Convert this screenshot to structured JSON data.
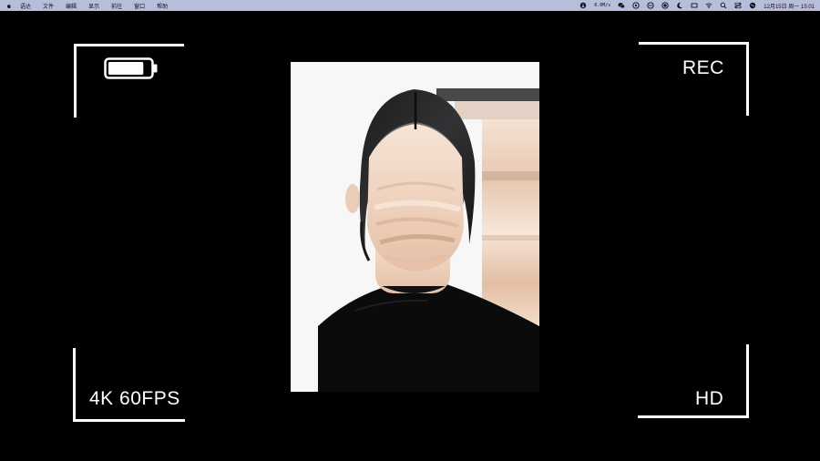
{
  "menubar": {
    "menus": [
      "语达",
      "文件",
      "编辑",
      "显示",
      "前往",
      "窗口",
      "帮助"
    ],
    "net_speed": "0.0M/s",
    "clock": "12月15日 周一 15:01",
    "icons": [
      "apple-icon",
      "network-speed-icon",
      "wechat-icon",
      "chat-icon",
      "screen-icon",
      "record-icon",
      "moon-icon",
      "display-icon",
      "wifi-icon",
      "search-icon",
      "control-center-icon",
      "siri-icon"
    ]
  },
  "viewfinder": {
    "rec_label": "REC",
    "resolution_label": "4K 60FPS",
    "quality_label": "HD",
    "battery_level": 0.85
  },
  "colors": {
    "background": "#000000",
    "overlay": "#ffffff",
    "menubar": "#b8bddb"
  }
}
